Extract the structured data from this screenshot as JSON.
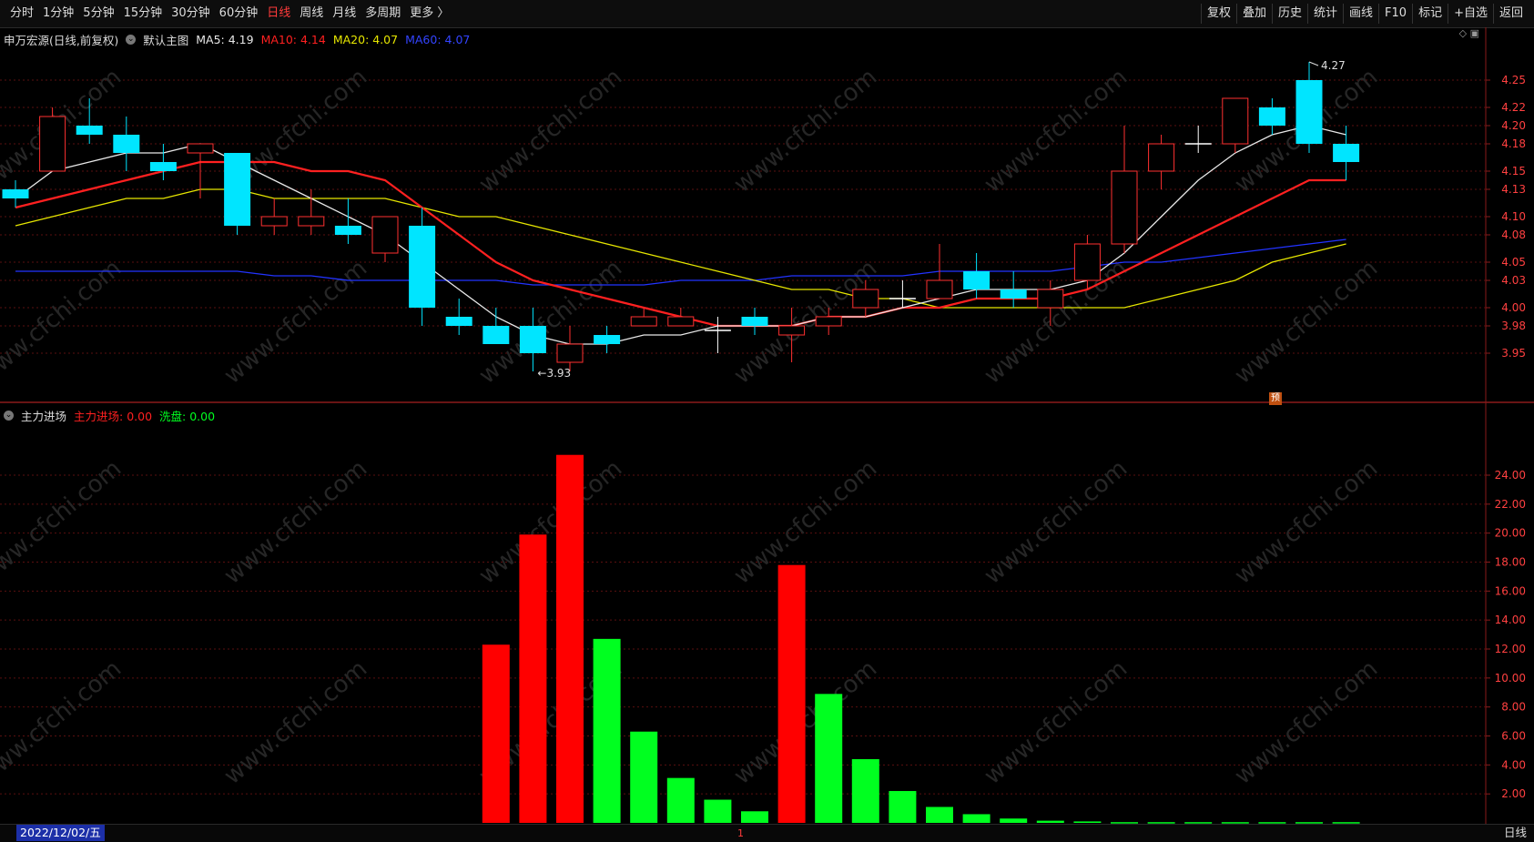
{
  "toolbar": {
    "left_items": [
      "分时",
      "1分钟",
      "5分钟",
      "15分钟",
      "30分钟",
      "60分钟",
      "日线",
      "周线",
      "月线",
      "多周期",
      "更多 〉"
    ],
    "active": "日线",
    "right_items": [
      "复权",
      "叠加",
      "历史",
      "统计",
      "画线",
      "F10",
      "标记",
      "+自选",
      "返回"
    ]
  },
  "main_legend": {
    "title": "申万宏源(日线,前复权)",
    "template": "默认主图",
    "ma5": "MA5: 4.19",
    "ma10": "MA10: 4.14",
    "ma20": "MA20: 4.07",
    "ma60": "MA60: 4.07"
  },
  "sub_legend": {
    "name": "主力进场",
    "series1": "主力进场: 0.00",
    "series2": "洗盘: 0.00"
  },
  "colors": {
    "up": "#ff3030",
    "down": "#00e5ff",
    "ma5": "#e8e8e8",
    "ma10": "#ff2020",
    "ma20": "#e6e600",
    "ma60": "#2233ff",
    "green": "#00ff20",
    "red": "#ff0000"
  },
  "price_axis": {
    "ticks": [
      "4.25",
      "4.22",
      "4.20",
      "4.18",
      "4.15",
      "4.13",
      "4.10",
      "4.08",
      "4.05",
      "4.03",
      "4.00",
      "3.98",
      "3.95"
    ],
    "min": 3.932,
    "max": 4.267
  },
  "annotations": {
    "high": "4.27",
    "low": "3.93",
    "badge": "预"
  },
  "sub_axis": {
    "ticks": [
      "24.00",
      "22.00",
      "20.00",
      "18.00",
      "16.00",
      "14.00",
      "12.00",
      "10.00",
      "8.00",
      "6.00",
      "4.00",
      "2.00"
    ],
    "max": 24
  },
  "candles": [
    {
      "o": 4.13,
      "c": 4.12,
      "h": 4.14,
      "l": 4.11
    },
    {
      "o": 4.15,
      "c": 4.21,
      "h": 4.22,
      "l": 4.15
    },
    {
      "o": 4.2,
      "c": 4.19,
      "h": 4.23,
      "l": 4.18
    },
    {
      "o": 4.19,
      "c": 4.17,
      "h": 4.21,
      "l": 4.15
    },
    {
      "o": 4.16,
      "c": 4.15,
      "h": 4.18,
      "l": 4.14
    },
    {
      "o": 4.17,
      "c": 4.18,
      "h": 4.18,
      "l": 4.12
    },
    {
      "o": 4.17,
      "c": 4.09,
      "h": 4.17,
      "l": 4.08
    },
    {
      "o": 4.09,
      "c": 4.1,
      "h": 4.12,
      "l": 4.08
    },
    {
      "o": 4.09,
      "c": 4.1,
      "h": 4.13,
      "l": 4.08
    },
    {
      "o": 4.09,
      "c": 4.08,
      "h": 4.12,
      "l": 4.07
    },
    {
      "o": 4.06,
      "c": 4.1,
      "h": 4.1,
      "l": 4.05
    },
    {
      "o": 4.09,
      "c": 4.0,
      "h": 4.11,
      "l": 3.98
    },
    {
      "o": 3.99,
      "c": 3.98,
      "h": 4.01,
      "l": 3.97
    },
    {
      "o": 3.98,
      "c": 3.96,
      "h": 4.0,
      "l": 3.96
    },
    {
      "o": 3.98,
      "c": 3.95,
      "h": 4.0,
      "l": 3.93
    },
    {
      "o": 3.94,
      "c": 3.96,
      "h": 3.98,
      "l": 3.93
    },
    {
      "o": 3.97,
      "c": 3.96,
      "h": 3.98,
      "l": 3.95
    },
    {
      "o": 3.98,
      "c": 3.99,
      "h": 4.0,
      "l": 3.98
    },
    {
      "o": 3.98,
      "c": 3.99,
      "h": 4.0,
      "l": 3.98
    },
    {
      "o": 3.975,
      "c": 3.975,
      "h": 3.99,
      "l": 3.95
    },
    {
      "o": 3.99,
      "c": 3.98,
      "h": 4.0,
      "l": 3.97
    },
    {
      "o": 3.97,
      "c": 3.98,
      "h": 4.0,
      "l": 3.94
    },
    {
      "o": 3.98,
      "c": 3.99,
      "h": 4.0,
      "l": 3.97
    },
    {
      "o": 4.0,
      "c": 4.02,
      "h": 4.03,
      "l": 3.99
    },
    {
      "o": 4.01,
      "c": 4.01,
      "h": 4.03,
      "l": 4.0
    },
    {
      "o": 4.01,
      "c": 4.03,
      "h": 4.07,
      "l": 4.01
    },
    {
      "o": 4.04,
      "c": 4.02,
      "h": 4.06,
      "l": 4.01
    },
    {
      "o": 4.02,
      "c": 4.01,
      "h": 4.04,
      "l": 4.0
    },
    {
      "o": 4.0,
      "c": 4.02,
      "h": 4.03,
      "l": 3.98
    },
    {
      "o": 4.03,
      "c": 4.07,
      "h": 4.08,
      "l": 4.02
    },
    {
      "o": 4.07,
      "c": 4.15,
      "h": 4.2,
      "l": 4.06
    },
    {
      "o": 4.15,
      "c": 4.18,
      "h": 4.19,
      "l": 4.13
    },
    {
      "o": 4.18,
      "c": 4.18,
      "h": 4.2,
      "l": 4.17
    },
    {
      "o": 4.18,
      "c": 4.23,
      "h": 4.23,
      "l": 4.17
    },
    {
      "o": 4.22,
      "c": 4.2,
      "h": 4.23,
      "l": 4.19
    },
    {
      "o": 4.25,
      "c": 4.18,
      "h": 4.27,
      "l": 4.17
    },
    {
      "o": 4.18,
      "c": 4.16,
      "h": 4.2,
      "l": 4.14
    }
  ],
  "ma5": [
    4.12,
    4.15,
    4.16,
    4.17,
    4.17,
    4.18,
    4.16,
    4.14,
    4.12,
    4.1,
    4.08,
    4.05,
    4.02,
    3.99,
    3.97,
    3.96,
    3.96,
    3.97,
    3.97,
    3.98,
    3.98,
    3.98,
    3.99,
    3.99,
    4.0,
    4.01,
    4.02,
    4.02,
    4.02,
    4.03,
    4.06,
    4.1,
    4.14,
    4.17,
    4.19,
    4.2,
    4.19
  ],
  "ma10": [
    4.11,
    4.12,
    4.13,
    4.14,
    4.15,
    4.16,
    4.16,
    4.16,
    4.15,
    4.15,
    4.14,
    4.11,
    4.08,
    4.05,
    4.03,
    4.02,
    4.01,
    4.0,
    3.99,
    3.98,
    3.98,
    3.98,
    3.99,
    3.99,
    4.0,
    4.0,
    4.01,
    4.01,
    4.01,
    4.02,
    4.04,
    4.06,
    4.08,
    4.1,
    4.12,
    4.14,
    4.14
  ],
  "ma20": [
    4.09,
    4.1,
    4.11,
    4.12,
    4.12,
    4.13,
    4.13,
    4.12,
    4.12,
    4.12,
    4.12,
    4.11,
    4.1,
    4.1,
    4.09,
    4.08,
    4.07,
    4.06,
    4.05,
    4.04,
    4.03,
    4.02,
    4.02,
    4.01,
    4.01,
    4.0,
    4.0,
    4.0,
    4.0,
    4.0,
    4.0,
    4.01,
    4.02,
    4.03,
    4.05,
    4.06,
    4.07
  ],
  "ma60": [
    4.04,
    4.04,
    4.04,
    4.04,
    4.04,
    4.04,
    4.04,
    4.035,
    4.035,
    4.03,
    4.03,
    4.03,
    4.03,
    4.03,
    4.025,
    4.025,
    4.025,
    4.025,
    4.03,
    4.03,
    4.03,
    4.035,
    4.035,
    4.035,
    4.035,
    4.04,
    4.04,
    4.04,
    4.04,
    4.045,
    4.05,
    4.05,
    4.055,
    4.06,
    4.065,
    4.07,
    4.075
  ],
  "sub_bars": [
    {
      "i": 13,
      "v": 12.3,
      "c": "red"
    },
    {
      "i": 14,
      "v": 19.9,
      "c": "red"
    },
    {
      "i": 15,
      "v": 25.4,
      "c": "red"
    },
    {
      "i": 16,
      "v": 12.7,
      "c": "green"
    },
    {
      "i": 17,
      "v": 6.3,
      "c": "green"
    },
    {
      "i": 18,
      "v": 3.1,
      "c": "green"
    },
    {
      "i": 19,
      "v": 1.6,
      "c": "green"
    },
    {
      "i": 20,
      "v": 0.8,
      "c": "green"
    },
    {
      "i": 21,
      "v": 17.8,
      "c": "red"
    },
    {
      "i": 22,
      "v": 8.9,
      "c": "green"
    },
    {
      "i": 23,
      "v": 4.4,
      "c": "green"
    },
    {
      "i": 24,
      "v": 2.2,
      "c": "green"
    },
    {
      "i": 25,
      "v": 1.1,
      "c": "green"
    },
    {
      "i": 26,
      "v": 0.6,
      "c": "green"
    },
    {
      "i": 27,
      "v": 0.3,
      "c": "green"
    },
    {
      "i": 28,
      "v": 0.15,
      "c": "green"
    },
    {
      "i": 29,
      "v": 0.1,
      "c": "green"
    },
    {
      "i": 30,
      "v": 0.05,
      "c": "green"
    },
    {
      "i": 31,
      "v": 0.05,
      "c": "green"
    },
    {
      "i": 32,
      "v": 0.05,
      "c": "green"
    },
    {
      "i": 33,
      "v": 0.05,
      "c": "green"
    },
    {
      "i": 34,
      "v": 0.05,
      "c": "green"
    },
    {
      "i": 35,
      "v": 0.05,
      "c": "green"
    },
    {
      "i": 36,
      "v": 0.05,
      "c": "green"
    }
  ],
  "watermark": "www.cfchi.com",
  "status": {
    "date": "2022/12/02/五",
    "period": "日线",
    "cursor": "1"
  }
}
